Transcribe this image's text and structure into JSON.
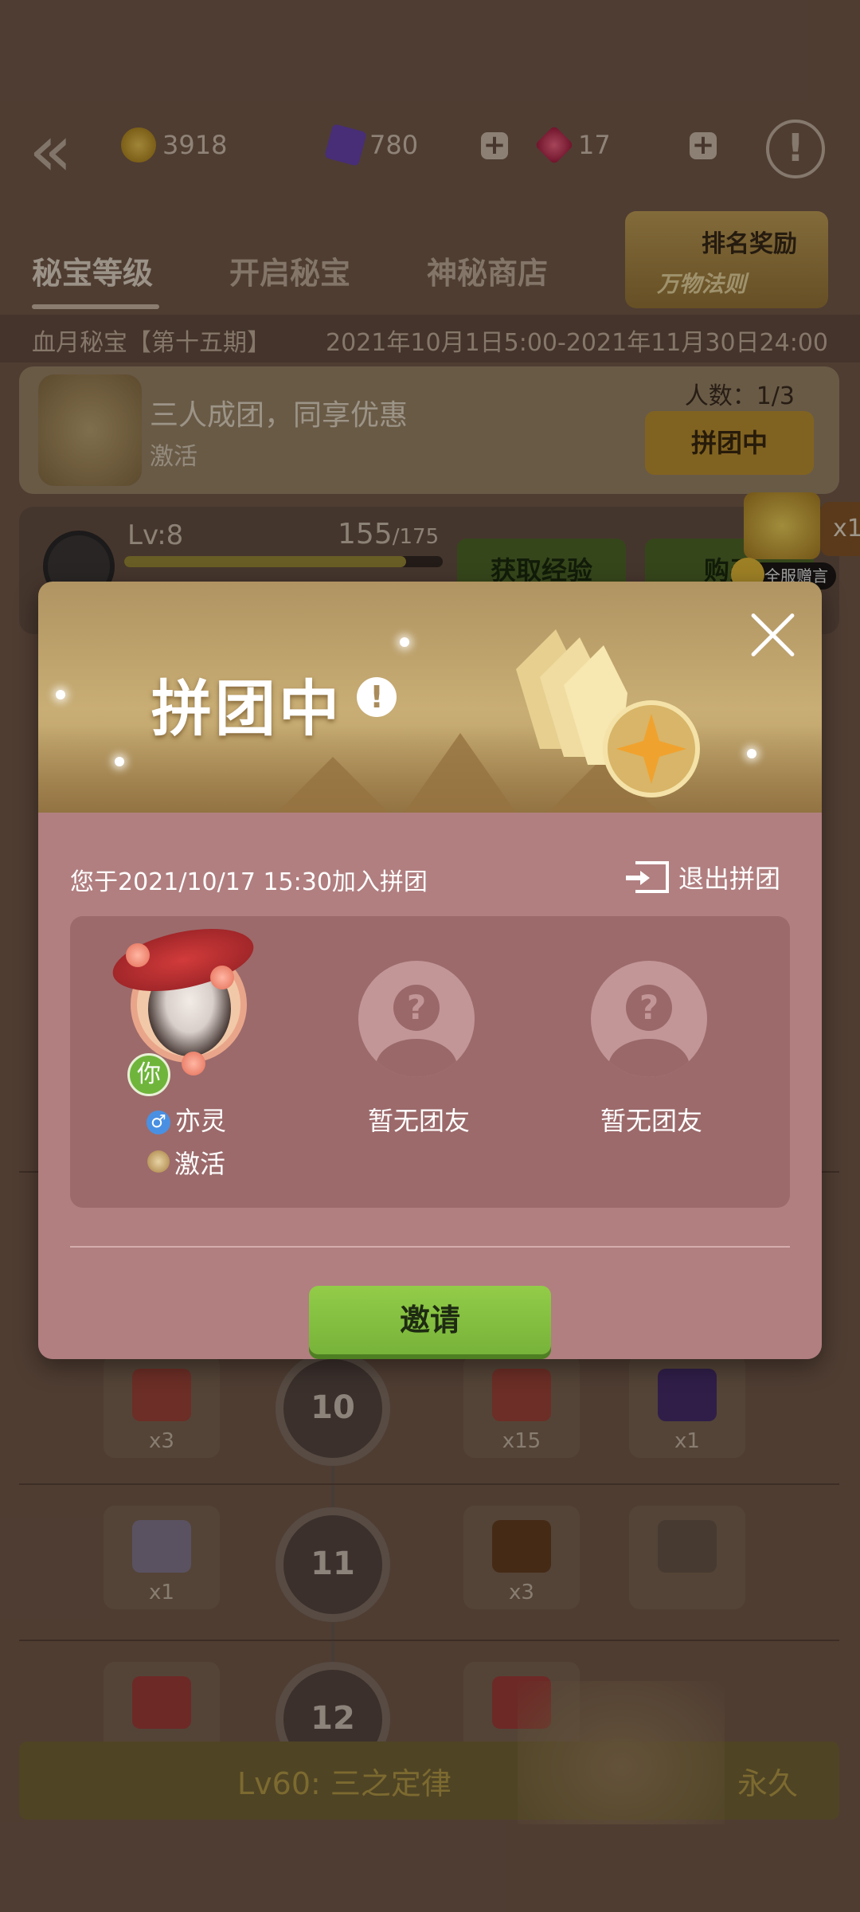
{
  "top": {
    "resources": [
      {
        "name": "gold-coin",
        "value": "3918"
      },
      {
        "name": "purple-card",
        "value": "780"
      },
      {
        "name": "red-gem",
        "value": "17"
      }
    ]
  },
  "rank_button": {
    "label": "排名奖励",
    "sub_label": "万物法则"
  },
  "tabs": [
    "秘宝等级",
    "开启秘宝",
    "神秘商店"
  ],
  "season": {
    "name": "血月秘宝【第十五期】",
    "dates": "2021年10月1日5:00-2021年11月30日24:00"
  },
  "group_panel": {
    "title": "三人成团，同享优惠",
    "status": "激活",
    "count": "人数：1/3",
    "button": "拼团中"
  },
  "level_panel": {
    "level": "Lv:8",
    "xp": "155",
    "xp_max": "/175",
    "xp_progress": 0.886,
    "get_xp": "获取经验",
    "buy": "购买"
  },
  "broadcast": {
    "label": "全服赠言",
    "side_tag": "x1"
  },
  "grid": {
    "rows": [
      {
        "node": "10",
        "items": [
          {
            "qty": "x3"
          },
          {
            "qty": "x15"
          },
          {
            "qty": "x1"
          }
        ]
      },
      {
        "node": "11",
        "items": [
          {
            "qty": "x1"
          },
          {
            "qty": "x3"
          },
          {
            "qty": ""
          }
        ]
      },
      {
        "node": "12",
        "items": [
          {
            "qty": ""
          },
          {
            "qty": ""
          }
        ]
      }
    ]
  },
  "bottom_bar": {
    "title": "Lv60: 三之定律",
    "duration": "永久"
  },
  "modal": {
    "title": "拼团中",
    "joined_text": "您于2021/10/17  15:30加入拼团",
    "exit_label": "退出拼团",
    "members": [
      {
        "badge": "你",
        "gender": "♂",
        "name": "亦灵",
        "status": "激活"
      },
      {
        "name": "暂无团友"
      },
      {
        "name": "暂无团友"
      }
    ],
    "invite_label": "邀请"
  }
}
